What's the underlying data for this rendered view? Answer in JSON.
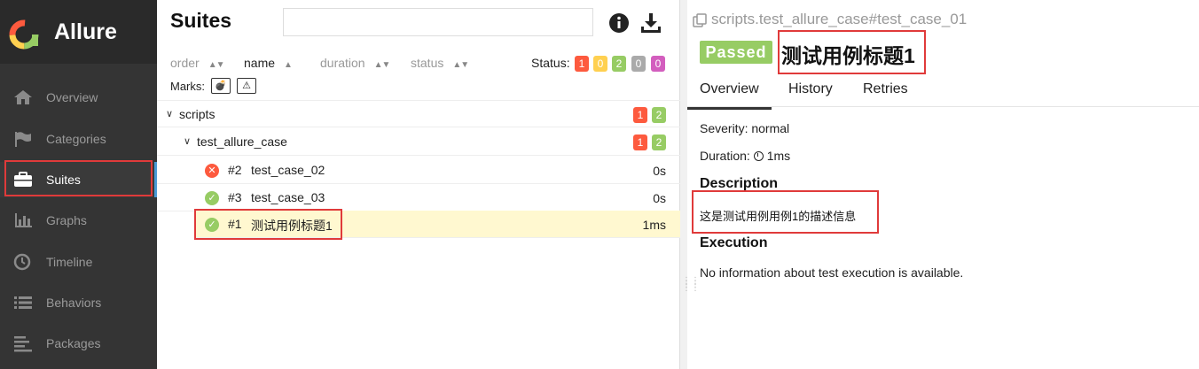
{
  "app": {
    "brand": "Allure"
  },
  "sidebar": {
    "items": [
      {
        "label": "Overview",
        "icon": "home-icon"
      },
      {
        "label": "Categories",
        "icon": "flag-icon"
      },
      {
        "label": "Suites",
        "icon": "briefcase-icon",
        "active": true
      },
      {
        "label": "Graphs",
        "icon": "bar-chart-icon"
      },
      {
        "label": "Timeline",
        "icon": "clock-icon"
      },
      {
        "label": "Behaviors",
        "icon": "list-icon"
      },
      {
        "label": "Packages",
        "icon": "align-left-icon"
      }
    ]
  },
  "suites": {
    "title": "Suites",
    "search": {
      "value": "",
      "placeholder": ""
    },
    "sort": {
      "order": "order",
      "name": "name",
      "duration": "duration",
      "status": "status"
    },
    "status_label": "Status:",
    "status_counts": [
      "1",
      "0",
      "2",
      "0",
      "0"
    ],
    "marks_label": "Marks:",
    "tree": {
      "root": {
        "name": "scripts",
        "failed": "1",
        "passed": "2"
      },
      "group": {
        "name": "test_allure_case",
        "failed": "1",
        "passed": "2"
      },
      "cases": [
        {
          "num": "#2",
          "name": "test_case_02",
          "duration": "0s",
          "status": "failed"
        },
        {
          "num": "#3",
          "name": "test_case_03",
          "duration": "0s",
          "status": "passed"
        },
        {
          "num": "#1",
          "name": "测试用例标题1",
          "duration": "1ms",
          "status": "passed",
          "selected": true
        }
      ]
    }
  },
  "detail": {
    "breadcrumb": "scripts.test_allure_case#test_case_01",
    "status_badge": "Passed",
    "title": "测试用例标题1",
    "tabs": [
      "Overview",
      "History",
      "Retries"
    ],
    "severity": "Severity: normal",
    "duration_label": "Duration:",
    "duration_value": "1ms",
    "description_heading": "Description",
    "description_text": "这是测试用例用例1的描述信息",
    "execution_heading": "Execution",
    "execution_text": "No information about test execution is available."
  },
  "colors": {
    "sidebar_bg": "#343434",
    "passed": "#97cc64",
    "failed": "#fd5a3e",
    "broken": "#ffd050",
    "skipped": "#aaaaaa",
    "unknown": "#d35ebe",
    "highlight_box": "#e03a3a",
    "selected_row": "#fff8d0"
  }
}
